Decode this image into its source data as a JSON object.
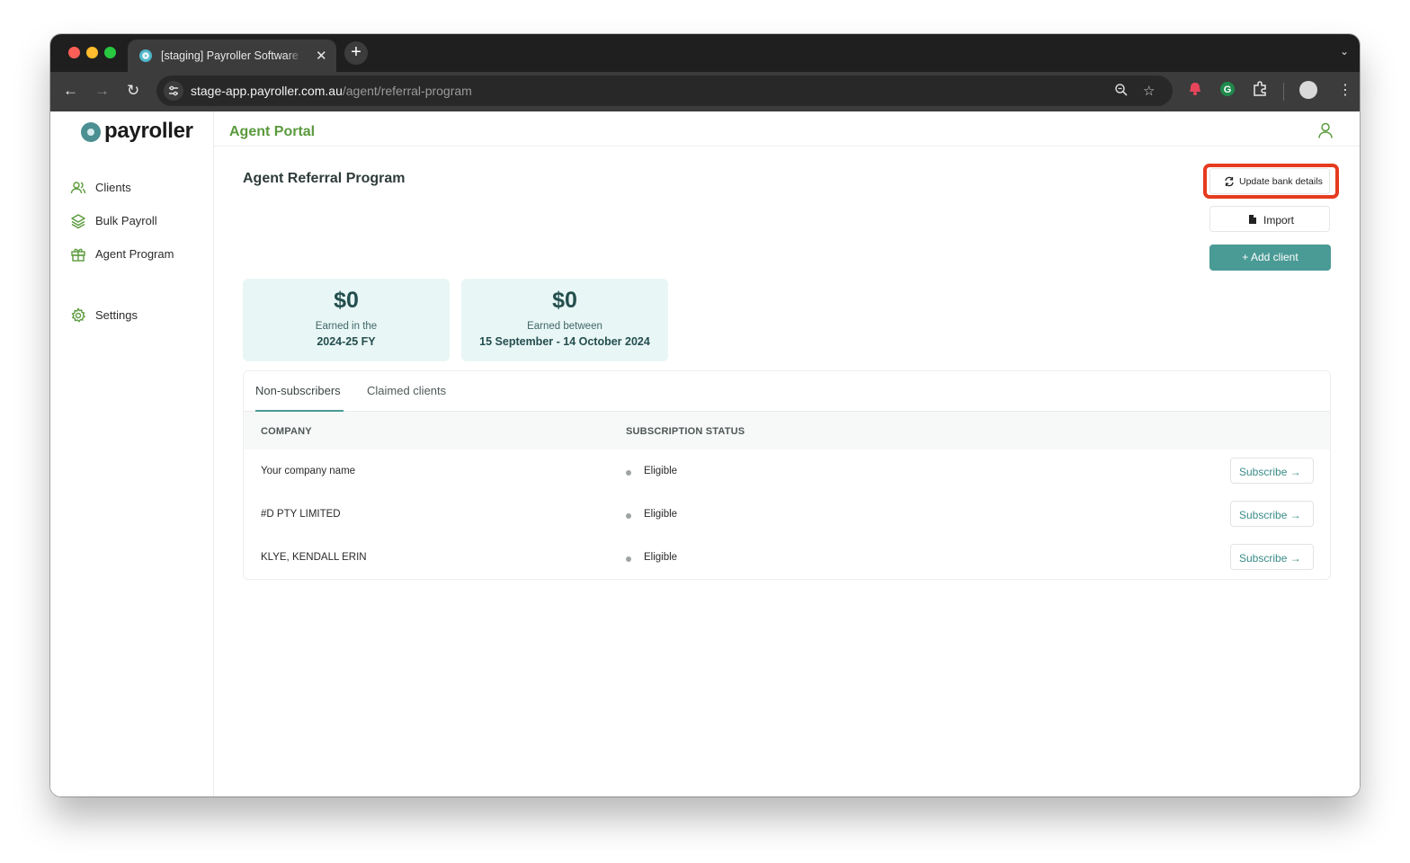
{
  "browser": {
    "tab_title": "[staging] Payroller Software W",
    "url_host": "stage-app.payroller.com.au",
    "url_path": "/agent/referral-program"
  },
  "app": {
    "logo_text": "payroller",
    "portal_title": "Agent Portal",
    "sidebar": [
      {
        "label": "Clients",
        "icon": "users-icon"
      },
      {
        "label": "Bulk Payroll",
        "icon": "layers-icon"
      },
      {
        "label": "Agent Program",
        "icon": "gift-icon"
      },
      {
        "label": "Settings",
        "icon": "gear-icon"
      }
    ],
    "page_title": "Agent Referral Program",
    "actions": {
      "update_bank": "Update bank details",
      "import": "Import",
      "add_client": "+ Add client"
    },
    "stats": [
      {
        "value": "$0",
        "label": "Earned in the",
        "period": "2024-25 FY"
      },
      {
        "value": "$0",
        "label": "Earned between",
        "period": "15 September - 14 October 2024"
      }
    ],
    "tabs": [
      "Non-subscribers",
      "Claimed clients"
    ],
    "active_tab": "Non-subscribers",
    "table": {
      "headers": [
        "COMPANY",
        "SUBSCRIPTION STATUS"
      ],
      "rows": [
        {
          "company": "Your company name",
          "status": "Eligible",
          "action": "Subscribe →"
        },
        {
          "company": "#D PTY LIMITED",
          "status": "Eligible",
          "action": "Subscribe →"
        },
        {
          "company": "KLYE, KENDALL ERIN",
          "status": "Eligible",
          "action": "Subscribe →"
        }
      ]
    },
    "colors": {
      "brand": "#5a9a3c",
      "teal": "#4a9a95",
      "highlight": "#e53b1f"
    }
  }
}
